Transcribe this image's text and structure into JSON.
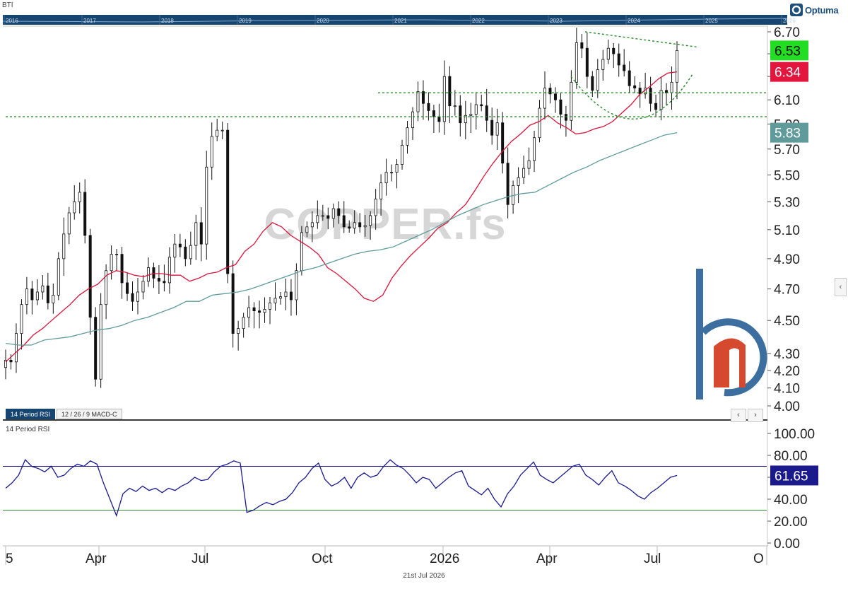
{
  "header": {
    "ticker": "BTI",
    "brand": "Optuma"
  },
  "navigator": {
    "years": [
      "2016",
      "2017",
      "2018",
      "2019",
      "2020",
      "2021",
      "2022",
      "2023",
      "2024",
      "2025",
      "2026"
    ]
  },
  "watermark": "COPPER.fs",
  "tabs": [
    "14 Period RSI",
    "12 / 26 / 9 MACD-C"
  ],
  "nav_buttons": {
    "prev": "‹",
    "next": "›",
    "collapse": "‹"
  },
  "footer": {
    "date": "21st Jul 2026"
  },
  "colors": {
    "ma_short": "#d8143a",
    "ma_long": "#5f9b9b",
    "rsi": "#1a1a8c",
    "rsi_upper": "#1a1a8c",
    "rsi_lower": "#2e8b2e",
    "trend_lines": "#2a8a2a",
    "badge_last": "#22dd22",
    "badge_ma_short": "#e3173e",
    "badge_ma_long": "#5f9b9b",
    "badge_rsi": "#1a1a8c",
    "navigator_bg": "#16456f",
    "logo_blue": "#3c6fa0",
    "logo_red": "#d5492f"
  },
  "chart_data": [
    {
      "type": "candlestick",
      "x_tick_labels": [
        "5",
        "Apr",
        "Jul",
        "Oct",
        "2026",
        "Apr",
        "Jul",
        "O"
      ],
      "y_tick_labels": [
        "6.70",
        "6.50",
        "6.30",
        "6.10",
        "5.90",
        "5.70",
        "5.50",
        "5.30",
        "5.10",
        "4.90",
        "4.70",
        "4.50",
        "4.30",
        "4.20",
        "4.10",
        "4.00"
      ],
      "ylim": [
        4.0,
        6.7
      ],
      "y_scale": "log",
      "close_series": [
        4.26,
        4.25,
        4.42,
        4.6,
        4.7,
        4.63,
        4.68,
        4.72,
        4.61,
        4.66,
        4.9,
        5.07,
        5.22,
        5.3,
        5.37,
        5.06,
        4.52,
        4.15,
        4.6,
        4.82,
        4.93,
        4.93,
        4.74,
        4.67,
        4.62,
        4.68,
        4.75,
        4.84,
        4.77,
        4.75,
        4.74,
        4.91,
        5.0,
        4.98,
        4.9,
        4.99,
        5.15,
        5.0,
        5.56,
        5.8,
        5.85,
        5.85,
        4.8,
        4.42,
        4.45,
        4.52,
        4.58,
        4.56,
        4.55,
        4.57,
        4.61,
        4.64,
        4.65,
        4.68,
        4.63,
        4.82,
        5.08,
        5.12,
        5.15,
        5.2,
        5.2,
        5.18,
        5.25,
        5.2,
        5.12,
        5.11,
        5.15,
        5.12,
        5.13,
        5.2,
        5.32,
        5.44,
        5.52,
        5.52,
        5.58,
        5.73,
        5.87,
        6.0,
        6.17,
        6.07,
        6.01,
        5.96,
        5.92,
        6.3,
        6.05,
        6.05,
        5.91,
        5.97,
        5.98,
        6.06,
        6.05,
        5.93,
        5.81,
        5.91,
        5.59,
        5.28,
        5.42,
        5.48,
        5.55,
        5.61,
        5.79,
        6.03,
        6.2,
        6.15,
        6.1,
        5.98,
        5.93,
        6.25,
        6.6,
        6.55,
        6.3,
        6.18,
        6.36,
        6.45,
        6.55,
        6.5,
        6.4,
        6.35,
        6.22,
        6.2,
        6.15,
        6.2,
        6.07,
        6.02,
        6.18,
        6.16,
        6.25,
        6.53
      ],
      "last_price": "6.53",
      "overlays": [
        {
          "name": "ma_short",
          "color": "#d8143a",
          "last": "6.34",
          "values": [
            4.25,
            4.3,
            4.35,
            4.41,
            4.45,
            4.5,
            4.55,
            4.6,
            4.66,
            4.7,
            4.73,
            4.79,
            4.82,
            4.81,
            4.79,
            4.78,
            4.8,
            4.8,
            4.79,
            4.79,
            4.75,
            4.77,
            4.8,
            4.81,
            4.84,
            4.86,
            4.95,
            5.0,
            5.09,
            5.15,
            5.12,
            5.06,
            5.02,
            4.98,
            4.93,
            4.84,
            4.8,
            4.75,
            4.7,
            4.64,
            4.62,
            4.66,
            4.77,
            4.85,
            4.92,
            4.98,
            5.04,
            5.11,
            5.15,
            5.22,
            5.28,
            5.38,
            5.49,
            5.59,
            5.68,
            5.76,
            5.82,
            5.89,
            5.92,
            5.97,
            5.91,
            5.87,
            5.82,
            5.83,
            5.86,
            5.88,
            5.92,
            5.99,
            6.06,
            6.15,
            6.21,
            6.28,
            6.33,
            6.34
          ]
        },
        {
          "name": "ma_long",
          "color": "#5f9b9b",
          "last": "5.83",
          "values": [
            4.36,
            4.35,
            4.35,
            4.38,
            4.39,
            4.4,
            4.42,
            4.44,
            4.45,
            4.47,
            4.5,
            4.52,
            4.55,
            4.58,
            4.62,
            4.62,
            4.66,
            4.67,
            4.68,
            4.7,
            4.73,
            4.76,
            4.79,
            4.82,
            4.84,
            4.87,
            4.9,
            4.93,
            4.95,
            4.96,
            4.98,
            5.02,
            5.06,
            5.1,
            5.15,
            5.2,
            5.24,
            5.28,
            5.31,
            5.34,
            5.36,
            5.37,
            5.42,
            5.47,
            5.52,
            5.56,
            5.61,
            5.65,
            5.69,
            5.73,
            5.77,
            5.81,
            5.83
          ]
        }
      ],
      "trendlines": [
        {
          "from": [
            "2025-12-05",
            6.16
          ],
          "to": [
            "2026-07-31",
            6.16
          ]
        },
        {
          "from": [
            "2025-01-01",
            5.96
          ],
          "to": [
            "2026-07-31",
            5.96
          ]
        },
        {
          "from": [
            "2026-05-10",
            6.7
          ],
          "to": [
            "2026-07-25",
            6.56
          ]
        }
      ]
    },
    {
      "type": "line",
      "series": [
        {
          "name": "14 Period RSI",
          "values": [
            50,
            55,
            62,
            76,
            70,
            68,
            65,
            70,
            60,
            62,
            68,
            72,
            70,
            75,
            72,
            55,
            40,
            25,
            45,
            50,
            47,
            52,
            48,
            50,
            46,
            50,
            48,
            52,
            55,
            60,
            57,
            58,
            65,
            70,
            72,
            75,
            73,
            28,
            30,
            34,
            37,
            35,
            38,
            40,
            46,
            55,
            60,
            68,
            73,
            58,
            52,
            55,
            60,
            50,
            60,
            64,
            60,
            62,
            70,
            76,
            71,
            68,
            62,
            55,
            60,
            58,
            50,
            55,
            60,
            64,
            66,
            52,
            48,
            44,
            50,
            40,
            33,
            45,
            52,
            62,
            68,
            74,
            62,
            58,
            55,
            60,
            65,
            70,
            72,
            62,
            58,
            53,
            60,
            66,
            55,
            52,
            48,
            43,
            40,
            46,
            50,
            55,
            60,
            61.65
          ]
        }
      ],
      "y_tick_labels": [
        "100.00",
        "80.00",
        "60.00",
        "40.00",
        "20.00",
        "0.00"
      ],
      "ylim": [
        0,
        100
      ],
      "levels": [
        70,
        30
      ],
      "last": "61.65"
    }
  ]
}
